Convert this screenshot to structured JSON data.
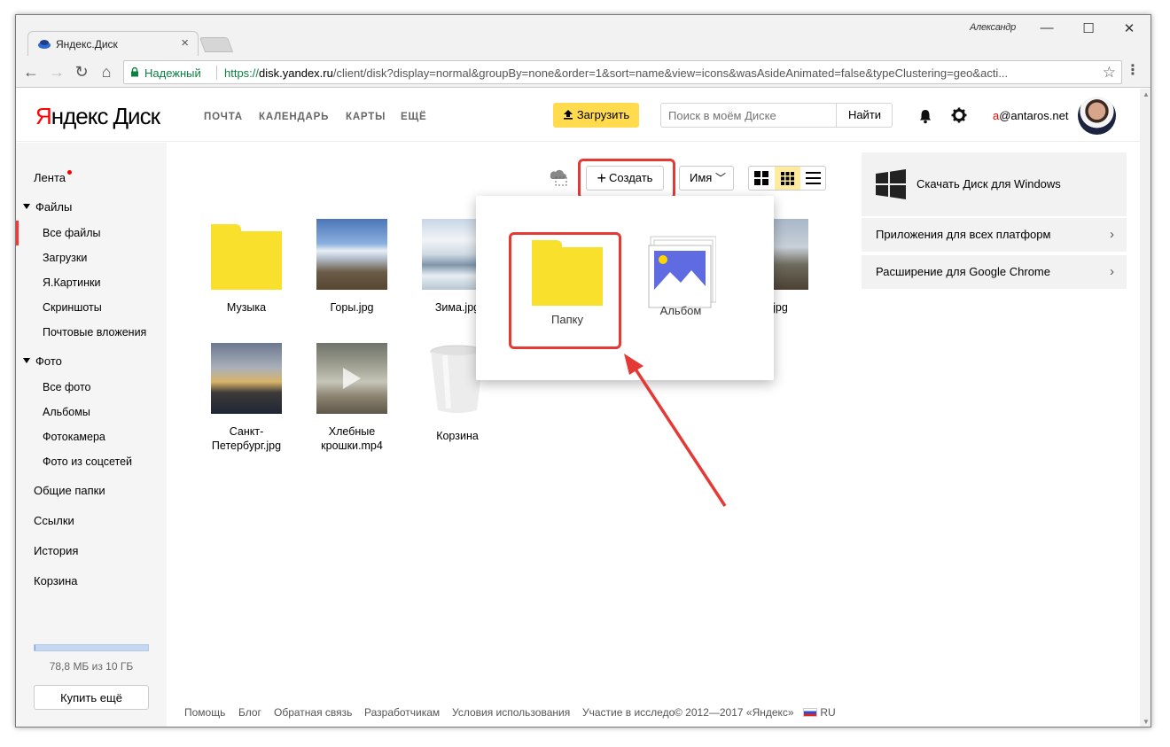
{
  "browser": {
    "tab_title": "Яндекс.Диск",
    "window_user": "Александр",
    "secure_label": "Надежный",
    "url_proto": "https://",
    "url_host": "disk.yandex.ru",
    "url_path": "/client/disk?display=normal&groupBy=none&order=1&sort=name&view=icons&wasAsideAnimated=false&typeClustering=geo&acti..."
  },
  "header": {
    "logo_ya": "Я",
    "logo_ndex": "ндекс",
    "logo_disk": "Диск",
    "nav": [
      "ПОЧТА",
      "КАЛЕНДАРЬ",
      "КАРТЫ",
      "ЕЩЁ"
    ],
    "upload_label": "Загрузить",
    "search_placeholder": "Поиск в моём Диске",
    "search_button": "Найти",
    "account_first": "a",
    "account_rest": "@antaros.net"
  },
  "sidebar": {
    "feed": "Лента",
    "files": "Файлы",
    "files_items": [
      "Все файлы",
      "Загрузки",
      "Я.Картинки",
      "Скриншоты",
      "Почтовые вложения"
    ],
    "photo": "Фото",
    "photo_items": [
      "Все фото",
      "Альбомы",
      "Фотокамера",
      "Фото из соцсетей"
    ],
    "shared": "Общие папки",
    "links": "Ссылки",
    "history": "История",
    "trash": "Корзина",
    "quota_text": "78,8 МБ из 10 ГБ",
    "quota_fraction": 0.0077,
    "buy_more": "Купить ещё"
  },
  "toolbar": {
    "create_label": "Создать",
    "sort_label": "Имя"
  },
  "files": [
    {
      "name": "Музыка",
      "kind": "folder"
    },
    {
      "name": "Горы.jpg",
      "kind": "photo"
    },
    {
      "name": "Зима.jpg",
      "kind": "photo"
    },
    {
      "name": "ва.jpg",
      "kind": "photo"
    },
    {
      "name": "Санкт-Петербург.jpg",
      "kind": "photo"
    },
    {
      "name": "Хлебные крошки.mp4",
      "kind": "video"
    },
    {
      "name": "Корзина",
      "kind": "trash"
    }
  ],
  "create_menu": {
    "folder_label": "Папку",
    "album_label": "Альбом"
  },
  "promo": {
    "download_windows": "Скачать Диск для Windows",
    "all_platforms": "Приложения для всех платформ",
    "chrome_extension": "Расширение для Google Chrome"
  },
  "footer": {
    "help": "Помощь",
    "blog": "Блог",
    "feedback": "Обратная связь",
    "developers": "Разработчикам",
    "terms": "Условия использования",
    "research": "Участие в исследо",
    "copyright": "© 2012—2017 «Яндекс»",
    "lang": "RU"
  },
  "colors": {
    "accent_yellow": "#ffdb4d",
    "folder_yellow": "#f8e02d",
    "highlight_red": "#e53935",
    "brand_red": "#ff0000"
  }
}
